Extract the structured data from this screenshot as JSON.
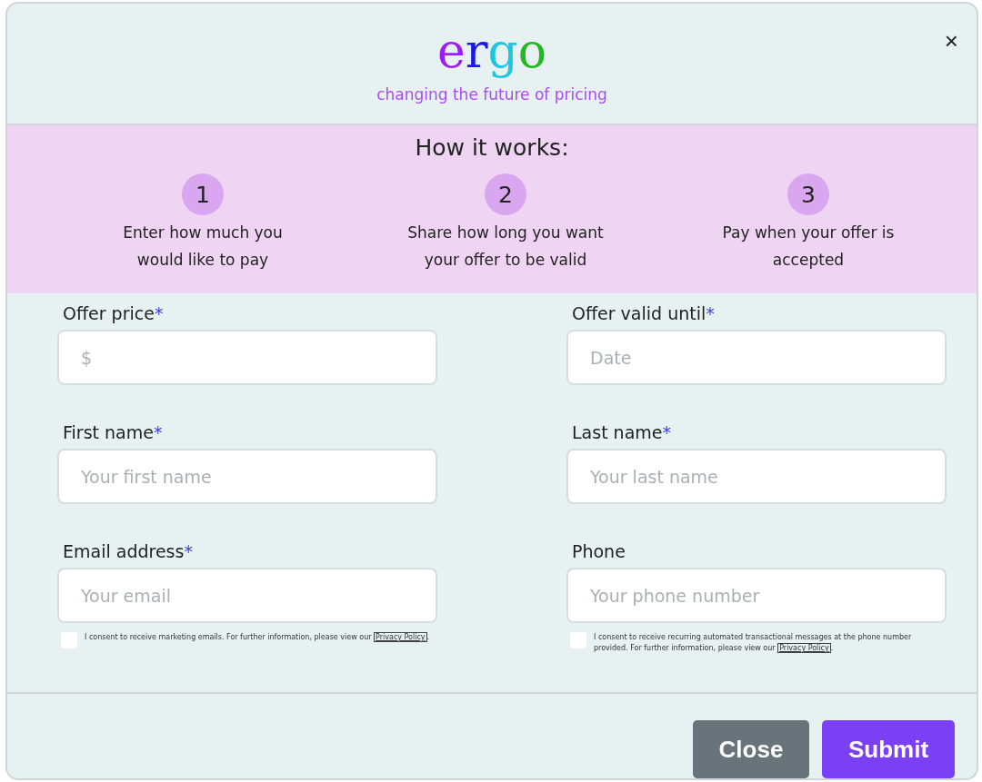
{
  "logo": [
    {
      "text": "e",
      "color": "#9b1ff2"
    },
    {
      "text": "r",
      "color": "#1c1ce0"
    },
    {
      "text": "g",
      "color": "#1ec6e2"
    },
    {
      "text": "o",
      "color": "#22b822"
    }
  ],
  "tagline": "changing the future of pricing",
  "close_icon": "×",
  "how_it_works": {
    "title": "How it works:",
    "steps": [
      {
        "number": "1",
        "text": "Enter how much you would like to pay"
      },
      {
        "number": "2",
        "text": "Share how long you want your offer to be valid"
      },
      {
        "number": "3",
        "text": "Pay when your offer is accepted"
      }
    ]
  },
  "fields": [
    {
      "label": "Offer price",
      "required": true,
      "placeholder": "$"
    },
    {
      "label": "Offer valid until",
      "required": true,
      "placeholder": "Date"
    },
    {
      "label": "First name",
      "required": true,
      "placeholder": "Your first name"
    },
    {
      "label": "Last name",
      "required": true,
      "placeholder": "Your last name"
    },
    {
      "label": "Email address",
      "required": true,
      "placeholder": "Your email"
    },
    {
      "label": "Phone",
      "required": false,
      "placeholder": "Your phone number"
    }
  ],
  "required_mark": "*",
  "consents": [
    {
      "text": "I consent to receive marketing emails. For further information, please view our",
      "link": "Privacy Policy",
      "after": ".",
      "checked": false
    },
    {
      "text": "I consent to receive recurring automated transactional messages at the phone number provided. For further information, please view our",
      "link": "Privacy Policy",
      "after": ".",
      "checked": false
    }
  ],
  "buttons": [
    {
      "label": "Close",
      "kind": "secondary"
    },
    {
      "label": "Submit",
      "kind": "primary"
    }
  ]
}
